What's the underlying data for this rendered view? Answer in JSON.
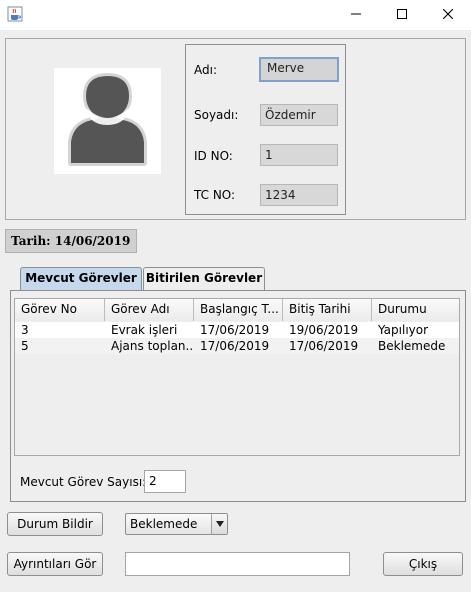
{
  "window": {
    "app_icon": "java-cup-icon",
    "controls": [
      "minimize-icon",
      "maximize-icon",
      "close-icon"
    ]
  },
  "profile": {
    "avatar_icon": "user-silhouette-icon",
    "fields": [
      {
        "label": "Adı:",
        "value": "Merve"
      },
      {
        "label": "Soyadı:",
        "value": "Özdemir"
      },
      {
        "label": "ID NO:",
        "value": "1"
      },
      {
        "label": "TC NO:",
        "value": "1234"
      }
    ]
  },
  "date_label": "Tarih: 14/06/2019",
  "tabs": [
    {
      "label": "Mevcut Görevler",
      "active": true
    },
    {
      "label": "Bitirilen Görevler",
      "active": false
    }
  ],
  "table": {
    "columns": [
      "Görev No",
      "Görev Adı",
      "Başlangıç T...",
      "Bitiş Tarihi",
      "Durumu"
    ],
    "rows": [
      [
        "3",
        "Evrak işleri",
        "17/06/2019",
        "19/06/2019",
        "Yapılıyor"
      ],
      [
        "5",
        "Ajans toplan...",
        "17/06/2019",
        "17/06/2019",
        "Beklemede"
      ]
    ]
  },
  "task_count": {
    "label": "Mevcut Görev Sayısı:",
    "value": "2"
  },
  "actions": {
    "report_status_button": "Durum Bildir",
    "status_select_value": "Beklemede",
    "details_button": "Ayrıntıları Gör",
    "details_input_value": "",
    "exit_button": "Çıkış"
  },
  "colors": {
    "active_tab": "#c6d8ec",
    "focused_field_border": "#7da2ce",
    "window_background": "#eeeeee"
  }
}
